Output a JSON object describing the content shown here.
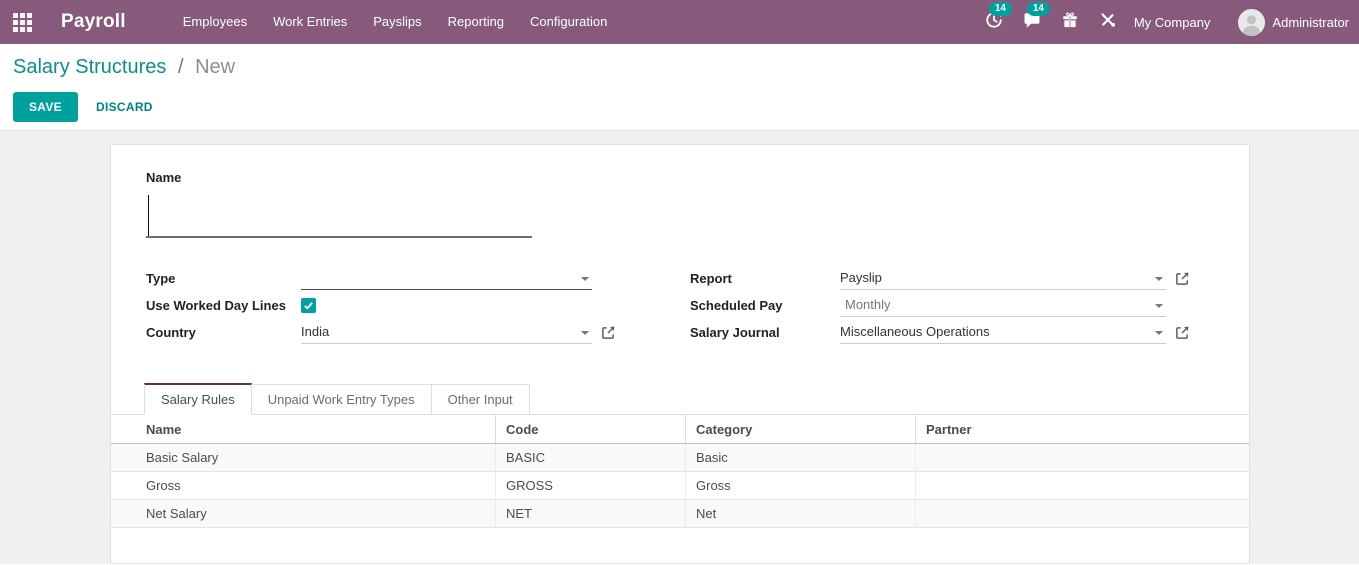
{
  "topbar": {
    "app_name": "Payroll",
    "menu": [
      "Employees",
      "Work Entries",
      "Payslips",
      "Reporting",
      "Configuration"
    ],
    "activities": {
      "count": "14",
      "icon": "clock-activity-icon"
    },
    "messages": {
      "count": "14",
      "icon": "chat-bubble-icon"
    },
    "extra_icons": [
      "gift-icon",
      "tools-icon"
    ],
    "company": "My Company",
    "user": "Administrator"
  },
  "breadcrumb": {
    "parent": "Salary Structures",
    "separator": "/",
    "current": "New"
  },
  "actions": {
    "save": "SAVE",
    "discard": "DISCARD"
  },
  "form": {
    "name": {
      "label": "Name",
      "value": ""
    },
    "fields": {
      "type": {
        "label": "Type",
        "value": ""
      },
      "use_worked_day_lines": {
        "label": "Use Worked Day Lines",
        "checked": true
      },
      "country": {
        "label": "Country",
        "value": "India"
      },
      "report": {
        "label": "Report",
        "value": "Payslip"
      },
      "scheduled_pay": {
        "label": "Scheduled Pay",
        "value": "Monthly"
      },
      "salary_journal": {
        "label": "Salary Journal",
        "value": "Miscellaneous Operations"
      }
    },
    "tabs": [
      "Salary Rules",
      "Unpaid Work Entry Types",
      "Other Input"
    ],
    "active_tab": "Salary Rules",
    "salary_rules_table": {
      "headers": [
        "Name",
        "Code",
        "Category",
        "Partner"
      ],
      "rows": [
        {
          "name": "Basic Salary",
          "code": "BASIC",
          "category": "Basic",
          "partner": ""
        },
        {
          "name": "Gross",
          "code": "GROSS",
          "category": "Gross",
          "partner": ""
        },
        {
          "name": "Net Salary",
          "code": "NET",
          "category": "Net",
          "partner": ""
        }
      ]
    }
  },
  "colors": {
    "topbar_bg": "#875A7B",
    "primary": "#00A09D",
    "link": "#0D8E8A",
    "badge_bg": "#00A09D",
    "tab_accent": "#692A52"
  }
}
